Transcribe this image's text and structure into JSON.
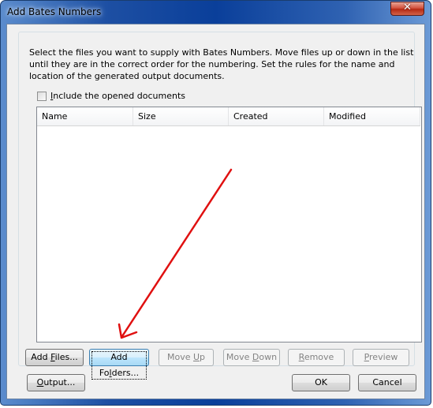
{
  "window": {
    "title": "Add Bates Numbers",
    "close_icon": "close-icon"
  },
  "description": "Select the files you want to supply with Bates Numbers. Move files up or down in the list until they are in the correct order for the numbering. Set the rules for the name and location of the generated output documents.",
  "include_opened": {
    "label_prefix": "",
    "label_accel": "I",
    "label_rest": "nclude the opened documents",
    "checked": false
  },
  "file_list": {
    "columns": [
      "Name",
      "Size",
      "Created",
      "Modified"
    ],
    "rows": []
  },
  "list_buttons": [
    {
      "pre": "Add ",
      "accel": "F",
      "post": "iles...",
      "enabled": true,
      "focused": false
    },
    {
      "pre": "Add Fo",
      "accel": "l",
      "post": "ders...",
      "enabled": true,
      "focused": true
    },
    {
      "pre": "Move ",
      "accel": "U",
      "post": "p",
      "enabled": false,
      "focused": false
    },
    {
      "pre": "Move ",
      "accel": "D",
      "post": "own",
      "enabled": false,
      "focused": false
    },
    {
      "pre": "",
      "accel": "R",
      "post": "emove",
      "enabled": false,
      "focused": false
    },
    {
      "pre": "",
      "accel": "P",
      "post": "review",
      "enabled": false,
      "focused": false
    }
  ],
  "footer": {
    "output": {
      "pre": "",
      "accel": "O",
      "post": "utput..."
    },
    "ok": "OK",
    "cancel": "Cancel"
  },
  "annotation": {
    "type": "arrow",
    "color": "#e01010",
    "points_to": "Add Folders..."
  }
}
